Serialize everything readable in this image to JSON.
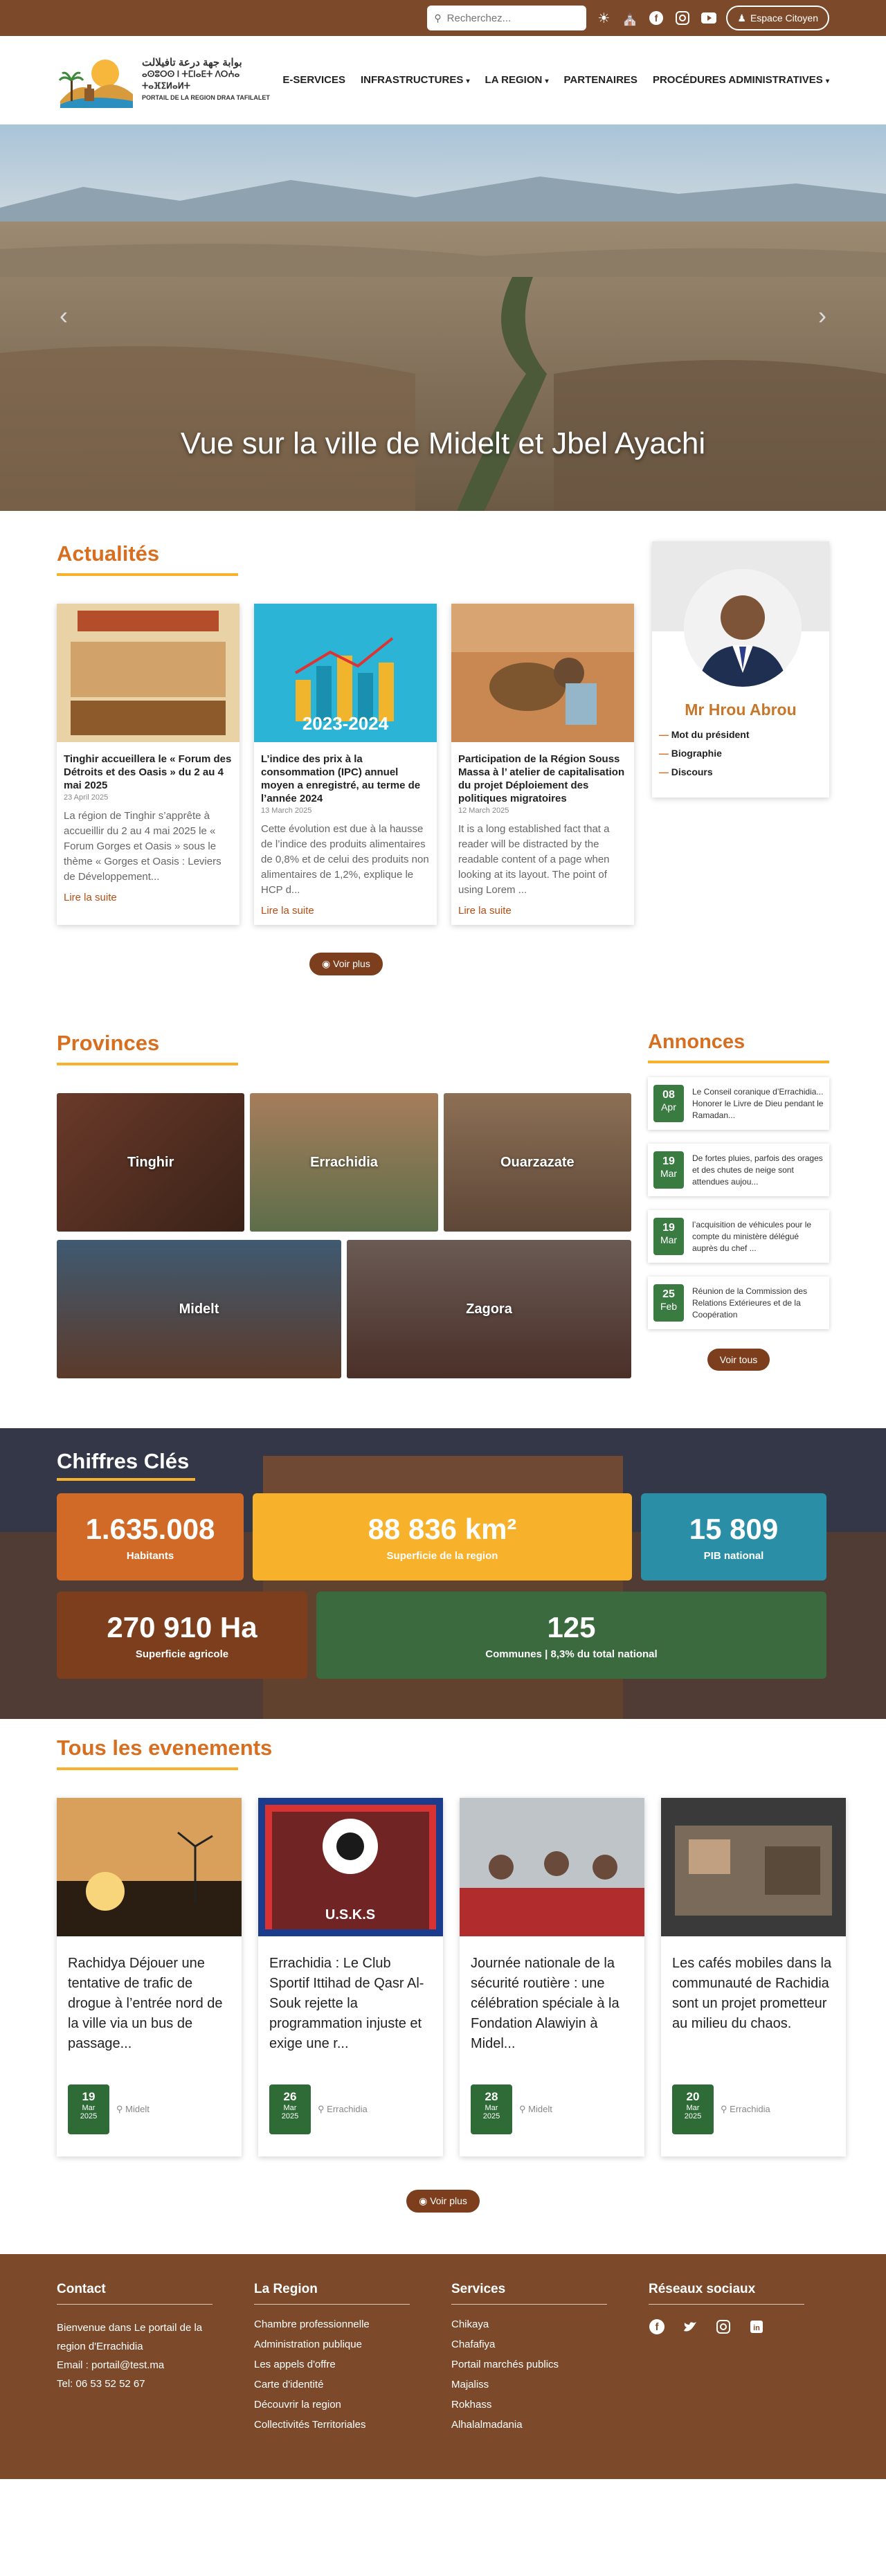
{
  "topbar": {
    "search_placeholder": "Recherchez...",
    "citoyen_label": "Espace Citoyen"
  },
  "header": {
    "logo_line1": "بوابة جهة درعة تافيلالت",
    "logo_line2": "ⴰⵙⵓⵔⵙ ⵏ ⵜⵎⵏⴰⴹⵜ ⴷⵔⵄⴰ ⵜⴰⴼⵉⵍⴰⵍⵜ",
    "logo_line3": "PORTAIL DE LA REGION DRAA TAFILALET",
    "nav": [
      "E-SERVICES",
      "INFRASTRUCTURES",
      "LA REGION",
      "PARTENAIRES",
      "PROCÉDURES ADMINISTRATIVES"
    ]
  },
  "hero": {
    "caption": "Vue sur la ville de Midelt et Jbel Ayachi",
    "prev": "‹",
    "next": "›"
  },
  "actualites": {
    "title": "Actualités",
    "cards": [
      {
        "title": "Tinghir accueillera le « Forum des Détroits et des Oasis » du 2 au 4 mai 2025",
        "date": "23 April 2025",
        "excerpt": "La région de Tinghir s’apprête à accueillir du 2 au 4 mai 2025 le « Forum Gorges et Oasis » sous le thème « Gorges et Oasis : Leviers de Développement...",
        "more": "Lire la suite"
      },
      {
        "title": "L’indice des prix à la consommation (IPC) annuel moyen a enregistré, au terme de l’année 2024",
        "date": "13 March 2025",
        "excerpt": "Cette évolution est due à la hausse de l’indice des produits alimentaires de 0,8% et de celui des produits non alimentaires de 1,2%, explique le HCP d...",
        "more": "Lire la suite",
        "img_text": "2023-2024"
      },
      {
        "title": "Participation de la Région Souss Massa à l’ atelier de capitalisation du projet Déploiement des politiques migratoires",
        "date": "12 March 2025",
        "excerpt": "It is a long established fact that a reader will be distracted by the readable content of a page when looking at its layout. The point of using Lorem ...",
        "more": "Lire la suite"
      }
    ],
    "voir_plus": "Voir plus"
  },
  "president": {
    "name": "Mr Hrou Abrou",
    "links": [
      "Mot du président",
      "Biographie",
      "Discours"
    ]
  },
  "provinces": {
    "title": "Provinces",
    "items": [
      "Tinghir",
      "Errachidia",
      "Ouarzazate",
      "Midelt",
      "Zagora"
    ]
  },
  "annonces": {
    "title": "Annonces",
    "items": [
      {
        "day": "08",
        "month": "Apr",
        "text": "Le Conseil coranique d’Errachidia... Honorer le Livre de Dieu pendant le Ramadan..."
      },
      {
        "day": "19",
        "month": "Mar",
        "text": "De fortes pluies, parfois des orages et des chutes de neige sont attendues aujou..."
      },
      {
        "day": "19",
        "month": "Mar",
        "text": "l’acquisition de véhicules pour le compte du ministère délégué auprès du chef ..."
      },
      {
        "day": "25",
        "month": "Feb",
        "text": "Réunion de la Commission des Relations Extérieures et de la Coopération"
      }
    ],
    "voir_tous": "Voir tous"
  },
  "chiffres": {
    "title": "Chiffres Clés",
    "stats": [
      {
        "value": "1.635.008",
        "label": "Habitants",
        "color": "#d06a26"
      },
      {
        "value": "88 836 km²",
        "label": "Superficie de la region",
        "color": "#f7b12b"
      },
      {
        "value": "15 809",
        "label": "PIB national",
        "color": "#2a8fa6"
      },
      {
        "value": "270 910 Ha",
        "label": "Superficie agricole",
        "color": "#7c3e1c"
      },
      {
        "value": "125",
        "label": "Communes | 8,3% du total national",
        "color": "#3a6a3d"
      }
    ]
  },
  "events": {
    "title": "Tous les evenements",
    "cards": [
      {
        "title": "Rachidya Déjouer une tentative de trafic de drogue à l’entrée nord de la ville via un bus de passage...",
        "day": "19",
        "month": "Mar",
        "year": "2025",
        "location": "Midelt"
      },
      {
        "title": "Errachidia : Le Club Sportif Ittihad de Qasr Al-Souk rejette la programmation injuste et exige une r...",
        "day": "26",
        "month": "Mar",
        "year": "2025",
        "location": "Errachidia",
        "img_text": "U.S.K.S"
      },
      {
        "title": "Journée nationale de la sécurité routière : une célébration spéciale à la Fondation Alawiyin à Midel...",
        "day": "28",
        "month": "Mar",
        "year": "2025",
        "location": "Midelt"
      },
      {
        "title": "Les cafés mobiles dans la communauté de Rachidia sont un projet prometteur au milieu du chaos.",
        "day": "20",
        "month": "Mar",
        "year": "2025",
        "location": "Errachidia"
      }
    ],
    "voir_plus": "Voir plus"
  },
  "footer": {
    "contact_title": "Contact",
    "contact_text": "Bienvenue dans Le portail de la region d'Errachidia",
    "contact_email": "Email : portail@test.ma",
    "contact_tel": "Tel: 06 53 52 52 67",
    "region_title": "La Region",
    "region_items": [
      "Chambre professionnelle",
      "Administration publique",
      "Les appels d'offre",
      "Carte d'identité",
      "Découvrir la region",
      "Collectivités Territoriales"
    ],
    "services_title": "Services",
    "services_items": [
      "Chikaya",
      "Chafafiya",
      "Portail marchés publics",
      "Majaliss",
      "Rokhass",
      "Alhalalmadania"
    ],
    "social_title": "Réseaux sociaux"
  }
}
